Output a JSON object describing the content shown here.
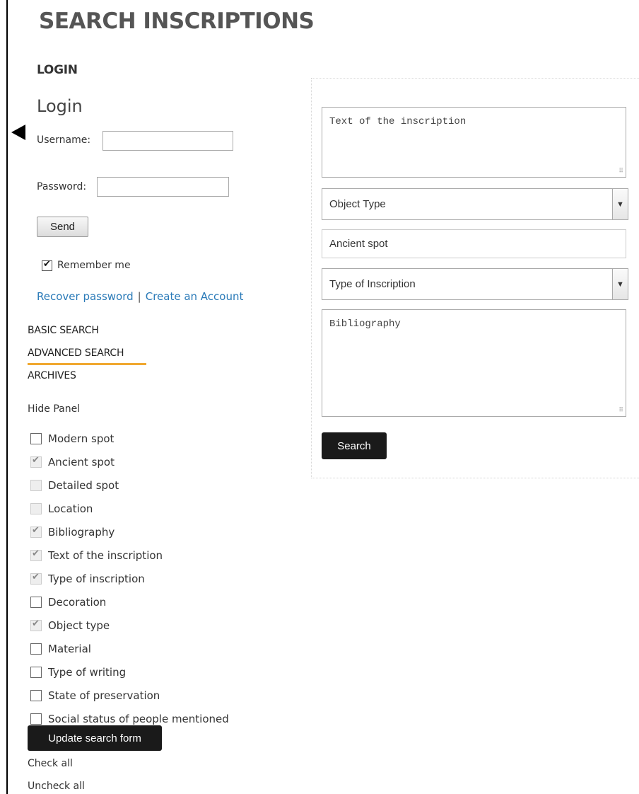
{
  "header": {
    "title": "SEARCH INSCRIPTIONS"
  },
  "login": {
    "section_title": "LOGIN",
    "heading": "Login",
    "username_label": "Username:",
    "username_value": "",
    "password_label": "Password:",
    "password_value": "",
    "send_label": "Send",
    "remember_label": "Remember me",
    "remember_checked": true,
    "recover_link": "Recover password",
    "separator": "|",
    "create_link": "Create an Account"
  },
  "nav": {
    "items": [
      {
        "label": "BASIC SEARCH",
        "active": false
      },
      {
        "label": "ADVANCED SEARCH",
        "active": true
      },
      {
        "label": "ARCHIVES",
        "active": false
      }
    ]
  },
  "panel_toggle": {
    "label": "Hide Panel"
  },
  "options": [
    {
      "label": "Modern spot",
      "checked": false,
      "enabled": true
    },
    {
      "label": "Ancient spot",
      "checked": true,
      "enabled": false
    },
    {
      "label": "Detailed spot",
      "checked": false,
      "enabled": false
    },
    {
      "label": "Location",
      "checked": false,
      "enabled": false
    },
    {
      "label": "Bibliography",
      "checked": true,
      "enabled": false
    },
    {
      "label": "Text of the inscription",
      "checked": true,
      "enabled": false
    },
    {
      "label": "Type of inscription",
      "checked": true,
      "enabled": false
    },
    {
      "label": "Decoration",
      "checked": false,
      "enabled": true
    },
    {
      "label": "Object type",
      "checked": true,
      "enabled": false
    },
    {
      "label": "Material",
      "checked": false,
      "enabled": true
    },
    {
      "label": "Type of writing",
      "checked": false,
      "enabled": true
    },
    {
      "label": "State of preservation",
      "checked": false,
      "enabled": true
    },
    {
      "label": "Social status of people mentioned",
      "checked": false,
      "enabled": true
    }
  ],
  "actions": {
    "update_label": "Update search form",
    "check_all": "Check all",
    "uncheck_all": "Uncheck all"
  },
  "form": {
    "text_placeholder": "Text of the inscription",
    "object_type_selected": "Object Type",
    "ancient_spot_placeholder": "Ancient spot",
    "inscription_type_selected": "Type of Inscription",
    "bibliography_placeholder": "Bibliography",
    "search_label": "Search"
  }
}
